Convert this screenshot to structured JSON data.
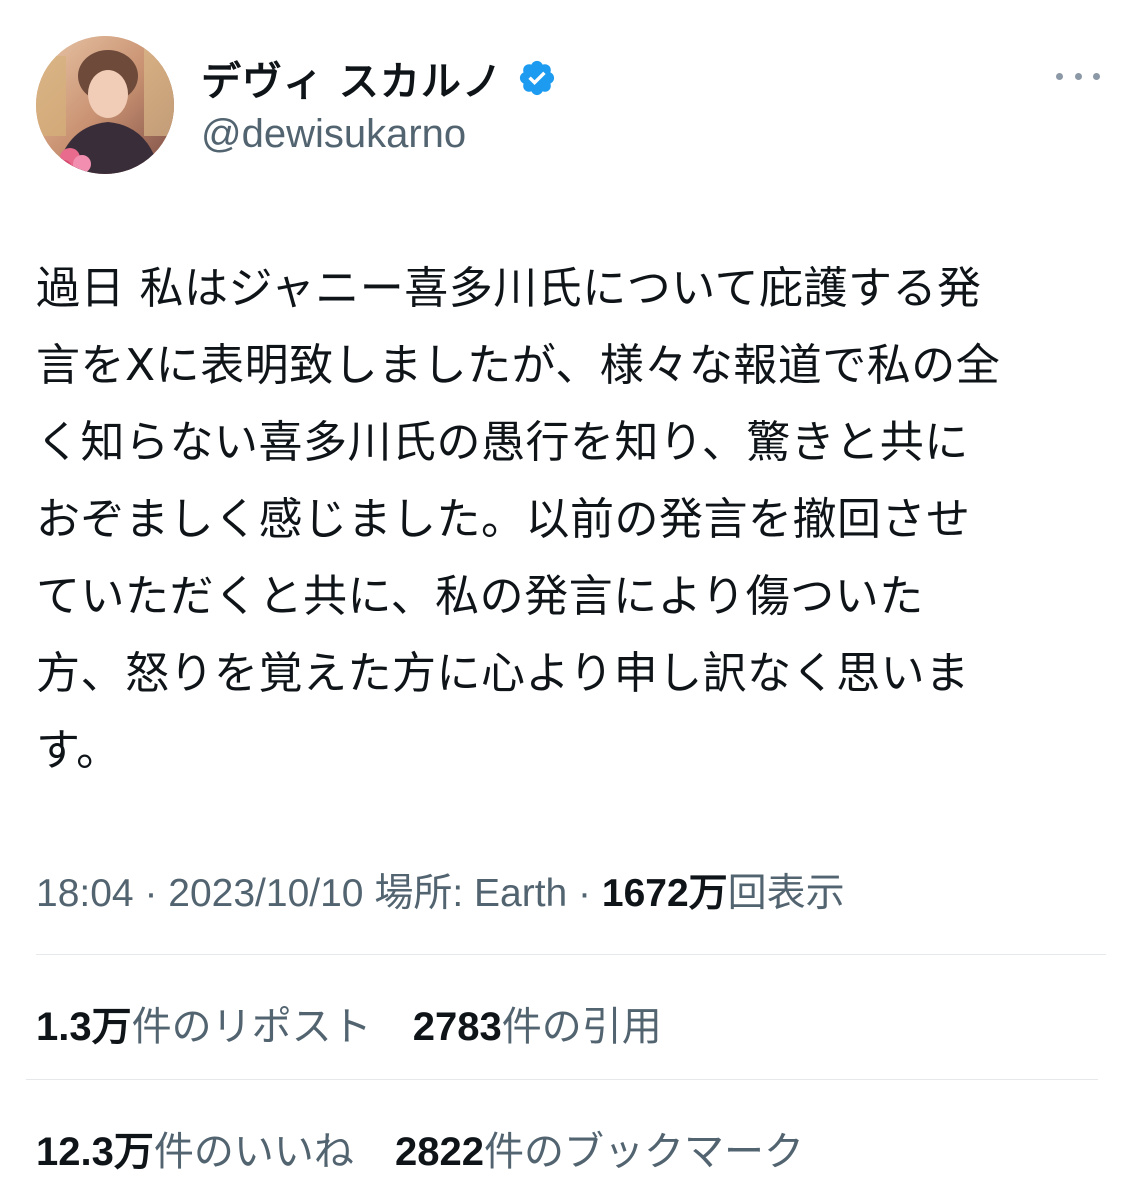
{
  "user": {
    "display_name": "デヴィ スカルノ",
    "handle": "@dewisukarno",
    "verified_icon": "verified-badge-icon",
    "verified_color": "#1d9bf0"
  },
  "more_icon": "more-horizontal-icon",
  "tweet": {
    "lines": [
      "過日 私はジャニー喜多川氏について庇護する発",
      "言をXに表明致しましたが、様々な報道で私の全",
      "く知らない喜多川氏の愚行を知り、驚きと共に",
      "おぞましく感じました。以前の発言を撤回させ",
      "ていただくと共に、私の発言により傷ついた",
      "方、怒りを覚えた方に心より申し訳なく思いま",
      "す。"
    ]
  },
  "meta": {
    "time": "18:04",
    "separator": " · ",
    "date": "2023/10/10",
    "location_label": "場所: Earth",
    "views_count": "1672万",
    "views_label": "回表示"
  },
  "stats": {
    "reposts": {
      "count": "1.3万",
      "label": "件のリポスト"
    },
    "quotes": {
      "count": "2783",
      "label": "件の引用"
    },
    "likes": {
      "count": "12.3万",
      "label": "件のいいね"
    },
    "bookmarks": {
      "count": "2822",
      "label": "件のブックマーク"
    }
  },
  "colors": {
    "text": "#0f1419",
    "secondary": "#536471",
    "divider": "#e6e9ec",
    "accent": "#1d9bf0"
  }
}
